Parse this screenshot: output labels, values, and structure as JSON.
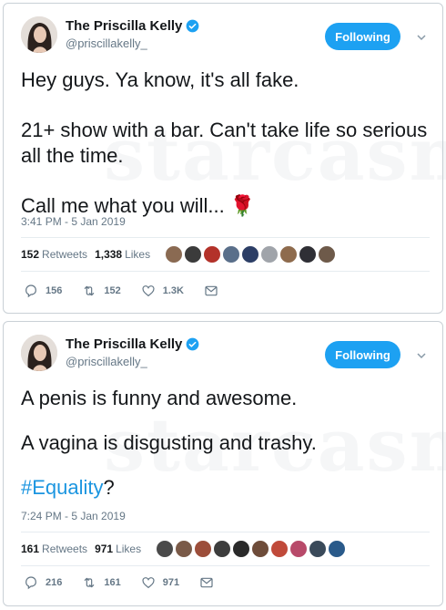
{
  "colors": {
    "accent": "#1da1f2",
    "hashtag": "#1b95e0",
    "text_primary": "#14171a",
    "text_secondary": "#657786",
    "border": "#c9d0d6"
  },
  "tweets": [
    {
      "author": {
        "name": "The Priscilla Kelly",
        "handle": "@priscillakelly_",
        "verified": true
      },
      "follow_label": "Following",
      "text": {
        "line1": "Hey guys. Ya know, it's all fake.",
        "line2": "21+ show with a bar. Can't take life so serious all the time.",
        "line3_prefix": "Call me what you will...",
        "line3_emoji": "🌹"
      },
      "timestamp": "3:41 PM - 5 Jan 2019",
      "stats": {
        "retweets_count": "152",
        "retweets_label": "Retweets",
        "likes_count": "1,338",
        "likes_label": "Likes"
      },
      "liker_colors": [
        "#8a6a52",
        "#3b3b3b",
        "#b3322a",
        "#5a6f8a",
        "#2c3e66",
        "#a0a4aa",
        "#8e6b4d",
        "#2f2f35",
        "#6e5a4a"
      ],
      "actions": {
        "replies": "156",
        "retweets": "152",
        "likes": "1.3K"
      }
    },
    {
      "author": {
        "name": "The Priscilla Kelly",
        "handle": "@priscillakelly_",
        "verified": true
      },
      "follow_label": "Following",
      "text": {
        "line1": "A penis is funny and awesome.",
        "line2": "A vagina is disgusting and trashy.",
        "hashtag": "#Equality",
        "hashtag_suffix": "?"
      },
      "timestamp": "7:24 PM - 5 Jan 2019",
      "stats": {
        "retweets_count": "161",
        "retweets_label": "Retweets",
        "likes_count": "971",
        "likes_label": "Likes"
      },
      "liker_colors": [
        "#4a4a4a",
        "#7a5a48",
        "#9c4e3a",
        "#3d3d3d",
        "#2a2a2a",
        "#6e4c3a",
        "#c04a3a",
        "#b84a6a",
        "#3a4a5a",
        "#2a5a8a"
      ],
      "actions": {
        "replies": "216",
        "retweets": "161",
        "likes": "971"
      }
    }
  ]
}
